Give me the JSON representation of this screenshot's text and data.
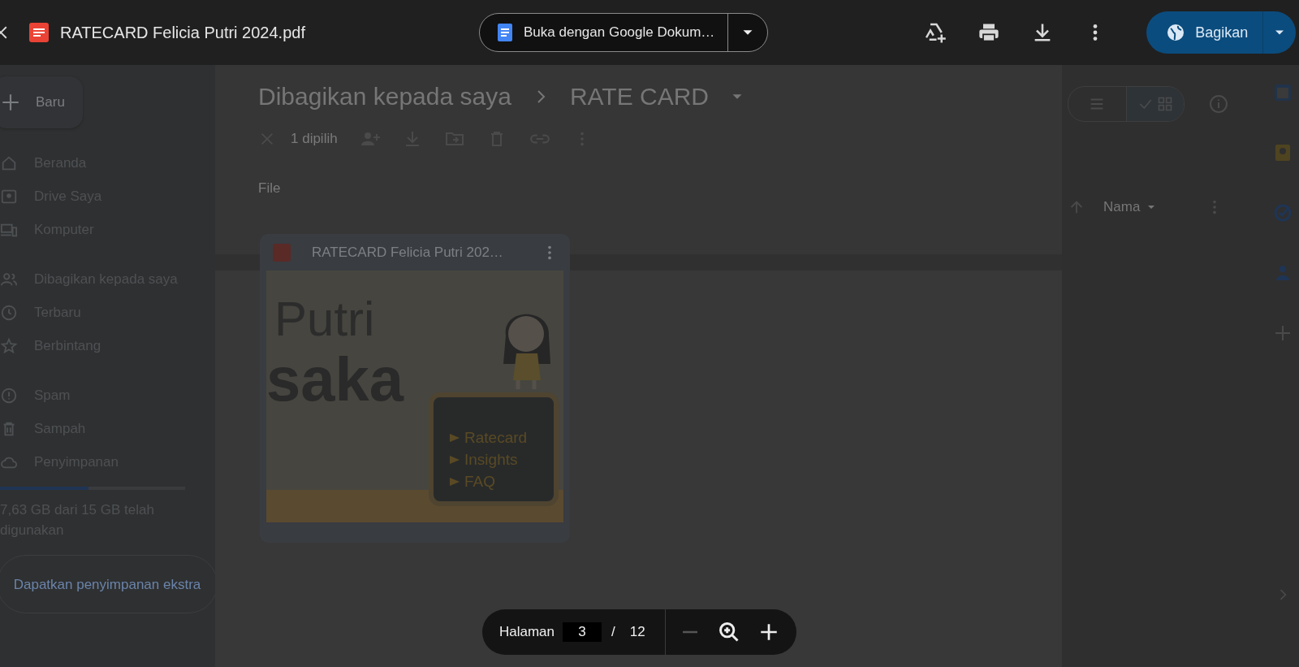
{
  "viewer": {
    "file_name": "RATECARD Felicia Putri 2024.pdf",
    "open_with": "Buka dengan Google Dokum…",
    "share_button": "Bagikan"
  },
  "drive": {
    "new_button": "Baru",
    "nav": [
      [
        "Beranda",
        "Drive Saya",
        "Komputer"
      ],
      [
        "Dibagikan kepada saya",
        "Terbaru",
        "Berbintang"
      ],
      [
        "Spam",
        "Sampah",
        "Penyimpanan"
      ]
    ],
    "storage": {
      "level": 0.48,
      "text": "7,63 GB dari 15 GB telah digunakan"
    },
    "storage_button": "Dapatkan penyimpanan ekstra",
    "breadcrumb": [
      "Dibagikan kepada saya",
      "RATE CARD"
    ],
    "selection": "1 dipilih",
    "section": "File",
    "file_card": {
      "name": "RATECARD Felicia Putri 202…",
      "title_lines": [
        "Putri",
        "saka"
      ],
      "menu": [
        "Ratecard",
        "Insights",
        "FAQ"
      ]
    },
    "sort": "Nama",
    "views": [
      {
        "selected": false
      },
      {
        "selected": true
      }
    ]
  },
  "page_nav": {
    "label": "Halaman",
    "page": "3",
    "separator": "/",
    "total": "12"
  }
}
